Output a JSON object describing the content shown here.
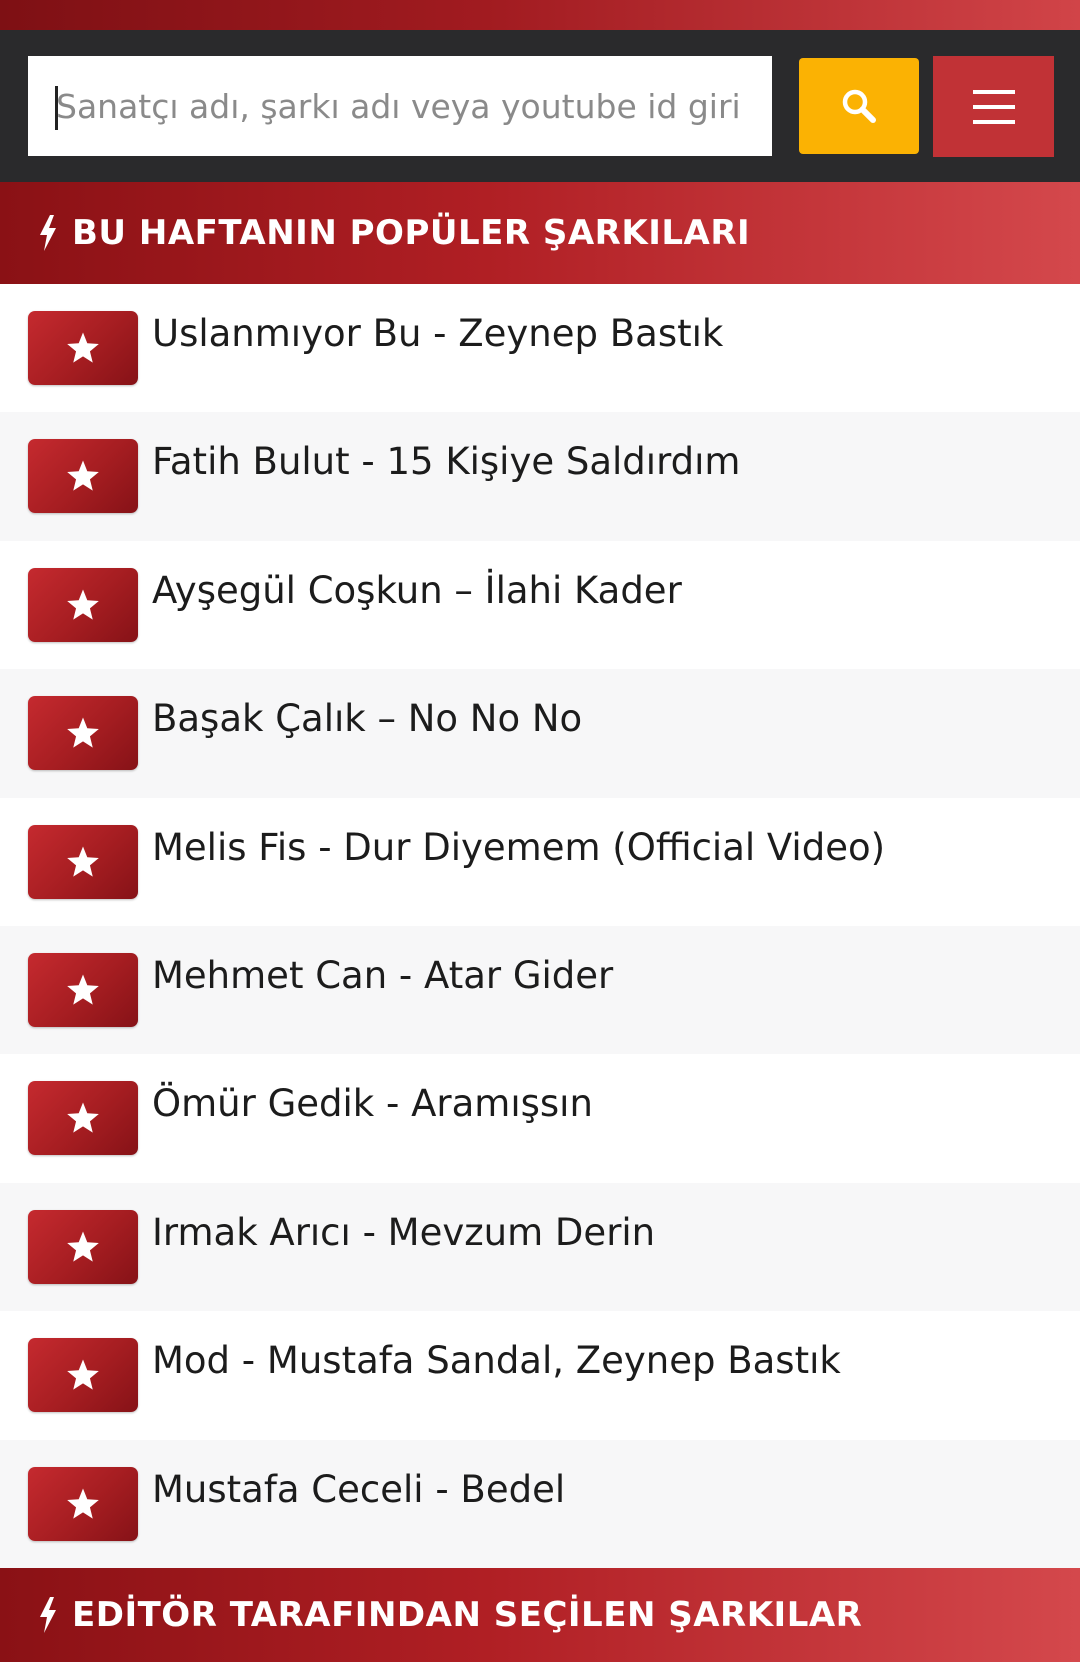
{
  "colors": {
    "accent_red": "#b01f24",
    "search_yellow": "#fbb203",
    "menu_red": "#c13236",
    "bar_dark": "#2a2a2c"
  },
  "search": {
    "placeholder": "Sanatçı adı, şarkı adı veya youtube id giri",
    "search_icon": "search-icon",
    "menu_icon": "hamburger-menu-icon"
  },
  "popular": {
    "icon": "lightning-bolt-icon",
    "title": "BU HAFTANIN POPÜLER ŞARKILARI",
    "songs": [
      "Uslanmıyor Bu - Zeynep Bastık",
      "Fatih Bulut - 15 Kişiye Saldırdım",
      "Ayşegül Coşkun – İlahi Kader",
      "Başak Çalık – No No No",
      "Melis Fis - Dur Diyemem (Official Video)",
      "Mehmet Can - Atar Gider",
      "Ömür Gedik - Aramışsın",
      "Irmak Arıcı - Mevzum Derin",
      "Mod - Mustafa Sandal, Zeynep Bastık",
      "Mustafa Ceceli - Bedel"
    ]
  },
  "editor": {
    "icon": "lightning-bolt-icon",
    "title": "EDİTÖR TARAFINDAN SEÇİLEN ŞARKILAR"
  }
}
